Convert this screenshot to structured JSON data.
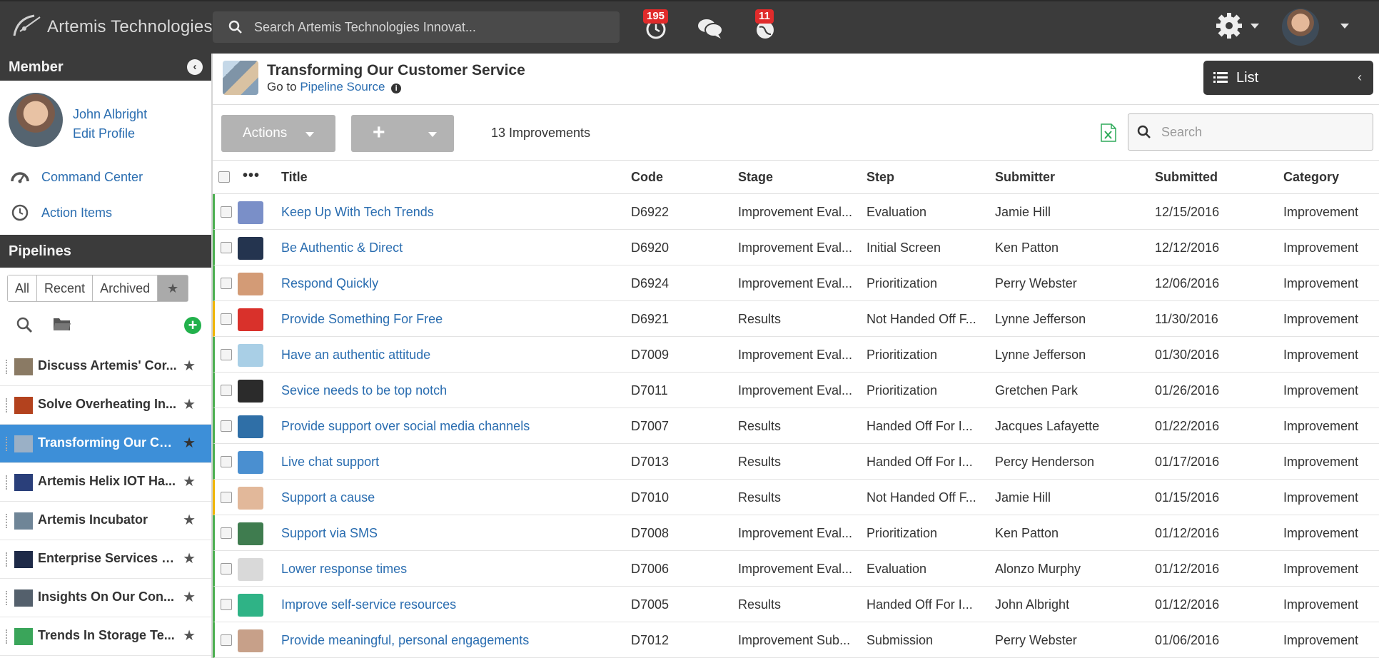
{
  "topbar": {
    "brand": "Artemis Technologies",
    "search_placeholder": "Search Artemis Technologies Innovat...",
    "badges": {
      "clock": "195",
      "globe": "11"
    }
  },
  "sidebar": {
    "member_heading": "Member",
    "member_name": "John Albright",
    "edit_profile": "Edit Profile",
    "links": [
      "Command Center",
      "Action Items"
    ],
    "pipelines_heading": "Pipelines",
    "tabs": [
      "All",
      "Recent",
      "Archived"
    ],
    "pipelines": [
      {
        "label": "Discuss Artemis' Cor...",
        "thumb": "#8a7a64"
      },
      {
        "label": "Solve Overheating In...",
        "thumb": "#b3421e"
      },
      {
        "label": "Transforming Our Cu...",
        "thumb": "#9ab0c6",
        "active": true
      },
      {
        "label": "Artemis Helix IOT Ha...",
        "thumb": "#2a3f7a"
      },
      {
        "label": "Artemis Incubator",
        "thumb": "#6f8597"
      },
      {
        "label": "Enterprise Services S...",
        "thumb": "#1e2a48"
      },
      {
        "label": "Insights On Our Con...",
        "thumb": "#54606c"
      },
      {
        "label": "Trends In Storage Te...",
        "thumb": "#3aa55a"
      }
    ]
  },
  "page": {
    "title": "Transforming Our Customer Service",
    "goto_prefix": "Go to",
    "goto_link": "Pipeline Source",
    "view_label": "List"
  },
  "toolbar": {
    "actions_label": "Actions",
    "add_label": "+",
    "count": "13 Improvements",
    "search_placeholder": "Search"
  },
  "table": {
    "headers": [
      "Title",
      "Code",
      "Stage",
      "Step",
      "Submitter",
      "Submitted",
      "Category"
    ],
    "rows": [
      {
        "title": "Keep Up With Tech Trends",
        "code": "D6922",
        "stage": "Improvement Eval...",
        "step": "Evaluation",
        "submitter": "Jamie Hill",
        "submitted": "12/15/2016",
        "category": "Improvement",
        "thumb": "#7a8fc8",
        "flag": "green"
      },
      {
        "title": "Be Authentic & Direct",
        "code": "D6920",
        "stage": "Improvement Eval...",
        "step": "Initial Screen",
        "submitter": "Ken Patton",
        "submitted": "12/12/2016",
        "category": "Improvement",
        "thumb": "#24344f",
        "flag": "green"
      },
      {
        "title": "Respond Quickly",
        "code": "D6924",
        "stage": "Improvement Eval...",
        "step": "Prioritization",
        "submitter": "Perry Webster",
        "submitted": "12/06/2016",
        "category": "Improvement",
        "thumb": "#d39b76",
        "flag": "green"
      },
      {
        "title": "Provide Something For Free",
        "code": "D6921",
        "stage": "Results",
        "step": "Not Handed Off F...",
        "submitter": "Lynne Jefferson",
        "submitted": "11/30/2016",
        "category": "Improvement",
        "thumb": "#d9312b",
        "flag": "amber"
      },
      {
        "title": "Have an authentic attitude",
        "code": "D7009",
        "stage": "Improvement Eval...",
        "step": "Prioritization",
        "submitter": "Lynne Jefferson",
        "submitted": "01/30/2016",
        "category": "Improvement",
        "thumb": "#a9cfe6",
        "flag": "green"
      },
      {
        "title": "Sevice needs to be top notch",
        "code": "D7011",
        "stage": "Improvement Eval...",
        "step": "Prioritization",
        "submitter": "Gretchen Park",
        "submitted": "01/26/2016",
        "category": "Improvement",
        "thumb": "#2b2b2b",
        "flag": "green"
      },
      {
        "title": "Provide support over social media channels",
        "code": "D7007",
        "stage": "Results",
        "step": "Handed Off For I...",
        "submitter": "Jacques Lafayette",
        "submitted": "01/22/2016",
        "category": "Improvement",
        "thumb": "#2f6fa7",
        "flag": "green"
      },
      {
        "title": "Live chat support",
        "code": "D7013",
        "stage": "Results",
        "step": "Handed Off For I...",
        "submitter": "Percy Henderson",
        "submitted": "01/17/2016",
        "category": "Improvement",
        "thumb": "#4a8fd0",
        "flag": "green"
      },
      {
        "title": "Support a cause",
        "code": "D7010",
        "stage": "Results",
        "step": "Not Handed Off F...",
        "submitter": "Jamie Hill",
        "submitted": "01/15/2016",
        "category": "Improvement",
        "thumb": "#e2b89a",
        "flag": "amber"
      },
      {
        "title": "Support via SMS",
        "code": "D7008",
        "stage": "Improvement Eval...",
        "step": "Prioritization",
        "submitter": "Ken Patton",
        "submitted": "01/12/2016",
        "category": "Improvement",
        "thumb": "#3f7c4f",
        "flag": "green"
      },
      {
        "title": "Lower response times",
        "code": "D7006",
        "stage": "Improvement Eval...",
        "step": "Evaluation",
        "submitter": "Alonzo Murphy",
        "submitted": "01/12/2016",
        "category": "Improvement",
        "thumb": "#d9d9d9",
        "flag": "green"
      },
      {
        "title": "Improve self-service resources",
        "code": "D7005",
        "stage": "Results",
        "step": "Handed Off For I...",
        "submitter": "John Albright",
        "submitted": "01/12/2016",
        "category": "Improvement",
        "thumb": "#2fb386",
        "flag": "green"
      },
      {
        "title": "Provide meaningful, personal engagements",
        "code": "D7012",
        "stage": "Improvement Sub...",
        "step": "Submission",
        "submitter": "Perry Webster",
        "submitted": "01/06/2016",
        "category": "Improvement",
        "thumb": "#c7a089",
        "flag": "green"
      }
    ]
  }
}
